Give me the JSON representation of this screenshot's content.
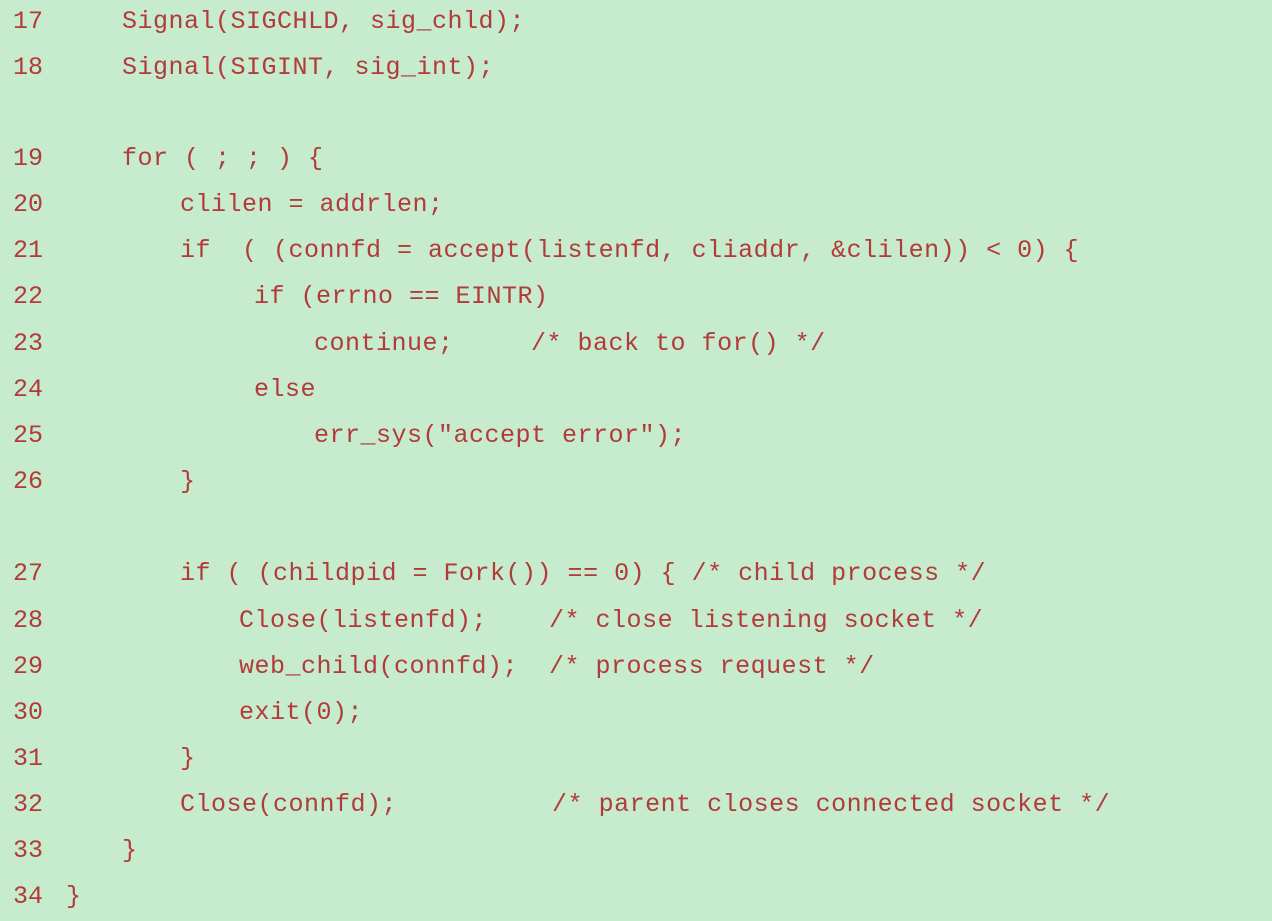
{
  "code": {
    "accent_color": "#b23a3a",
    "background_color": "#c7ebcd",
    "lines": [
      {
        "num": "17",
        "text": "Signal(SIGCHLD, sig_chld);"
      },
      {
        "num": "18",
        "text": "Signal(SIGINT, sig_int);"
      },
      {
        "num": "19",
        "text": "for ( ; ; ) {"
      },
      {
        "num": "20",
        "text": "clilen = addrlen;"
      },
      {
        "num": "21",
        "text": "if  ( (connfd = accept(listenfd, cliaddr, &clilen)) < 0) {"
      },
      {
        "num": "22",
        "text": "if (errno == EINTR)"
      },
      {
        "num": "23",
        "text": "continue;     /* back to for() */"
      },
      {
        "num": "24",
        "text": "else"
      },
      {
        "num": "25",
        "text": "err_sys(\"accept error\");"
      },
      {
        "num": "26",
        "text": "}"
      },
      {
        "num": "27",
        "text": "if ( (childpid = Fork()) == 0) { /* child process */"
      },
      {
        "num": "28",
        "text": "Close(listenfd);    /* close listening socket */"
      },
      {
        "num": "29",
        "text": "web_child(connfd);  /* process request */"
      },
      {
        "num": "30",
        "text": "exit(0);"
      },
      {
        "num": "31",
        "text": "}"
      },
      {
        "num": "32",
        "text": "Close(connfd);          /* parent closes connected socket */"
      },
      {
        "num": "33",
        "text": "}"
      },
      {
        "num": "34",
        "text": "}"
      }
    ]
  }
}
